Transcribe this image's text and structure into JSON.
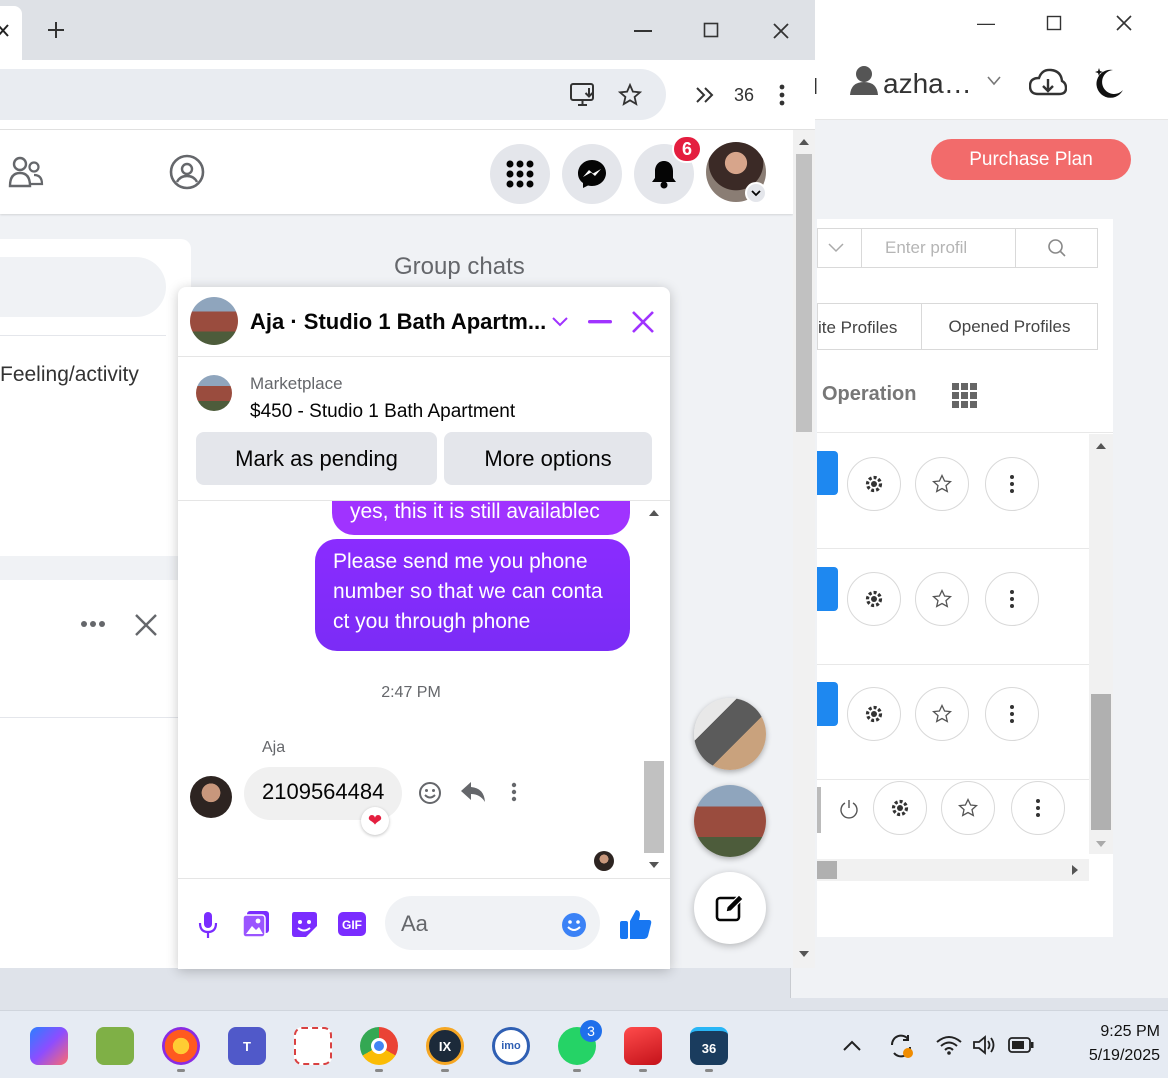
{
  "back_window": {
    "user_name": "azha…",
    "purchase_label": "Purchase Plan",
    "search_placeholder": "Enter profil",
    "tab_favorite": "ite Profiles",
    "tab_opened": "Opened Profiles",
    "operation_label": "Operation",
    "accent_color": "#1e88f0",
    "purchase_color": "#f26b6b"
  },
  "chrome": {
    "extension_count": "36"
  },
  "facebook": {
    "notification_count": "6",
    "feeling_label": "Feeling/activity",
    "group_chats_label": "Group chats"
  },
  "chat": {
    "title": "Aja · Studio 1 Bath Apartm...",
    "marketplace_label": "Marketplace",
    "listing_title": "$450 - Studio 1 Bath Apartment",
    "mark_pending_label": "Mark as pending",
    "more_options_label": "More options",
    "messages": {
      "out_1": "yes, this it is still availablec",
      "out_2": "Please send me you phone number so that we can conta ct you through phone",
      "timestamp": "2:47 PM",
      "sender": "Aja",
      "in_1": "2109564484"
    },
    "composer_placeholder": "Aa",
    "bubble_gradient": [
      "#a033ff",
      "#7a2cff"
    ],
    "accent_color": "#0084ff"
  },
  "taskbar": {
    "whatsapp_badge": "3",
    "app_36_label": "36",
    "time": "9:25 PM",
    "date": "5/19/2025"
  }
}
